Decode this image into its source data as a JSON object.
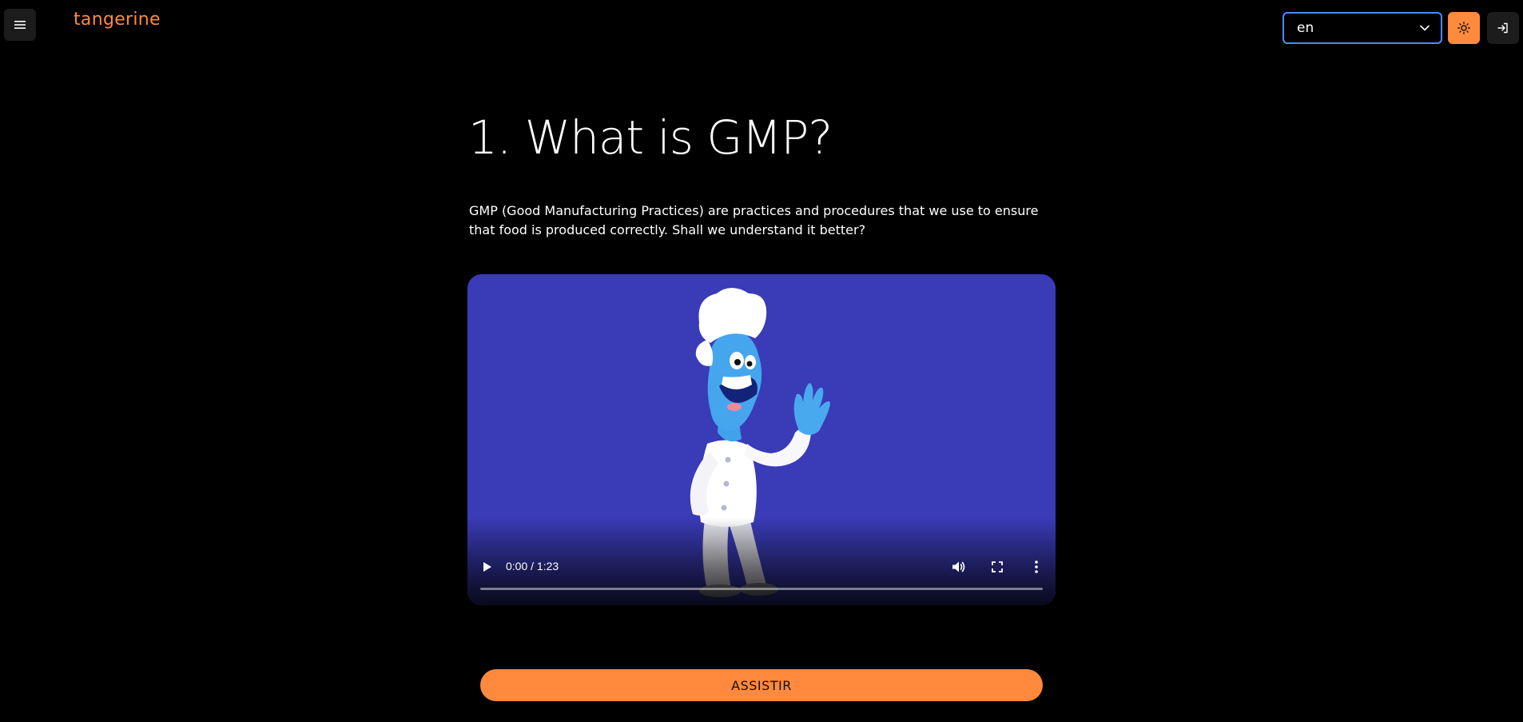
{
  "header": {
    "logo_text": "tangerine",
    "menu_icon": "hamburger-menu-icon",
    "language_select": {
      "value": "en",
      "chevron_icon": "chevron-down-icon"
    },
    "theme_toggle_icon": "sun-icon",
    "logout_icon": "logout-icon"
  },
  "lesson": {
    "title": "1. What is GMP?",
    "intro": "GMP (Good Manufacturing Practices) are practices and procedures that we use to ensure that food is produced correctly. Shall we understand it better?"
  },
  "video": {
    "time_display": "0:00 / 1:23",
    "progress": 0,
    "play_icon": "play-icon",
    "volume_icon": "volume-icon",
    "fullscreen_icon": "fullscreen-icon",
    "more_icon": "more-vertical-icon"
  },
  "cta": {
    "label": "ASSISTIR"
  },
  "colors": {
    "accent": "#ff8a3d",
    "background": "#000000",
    "video_background": "#3a3bb7",
    "focus_ring": "#4a8cff"
  }
}
